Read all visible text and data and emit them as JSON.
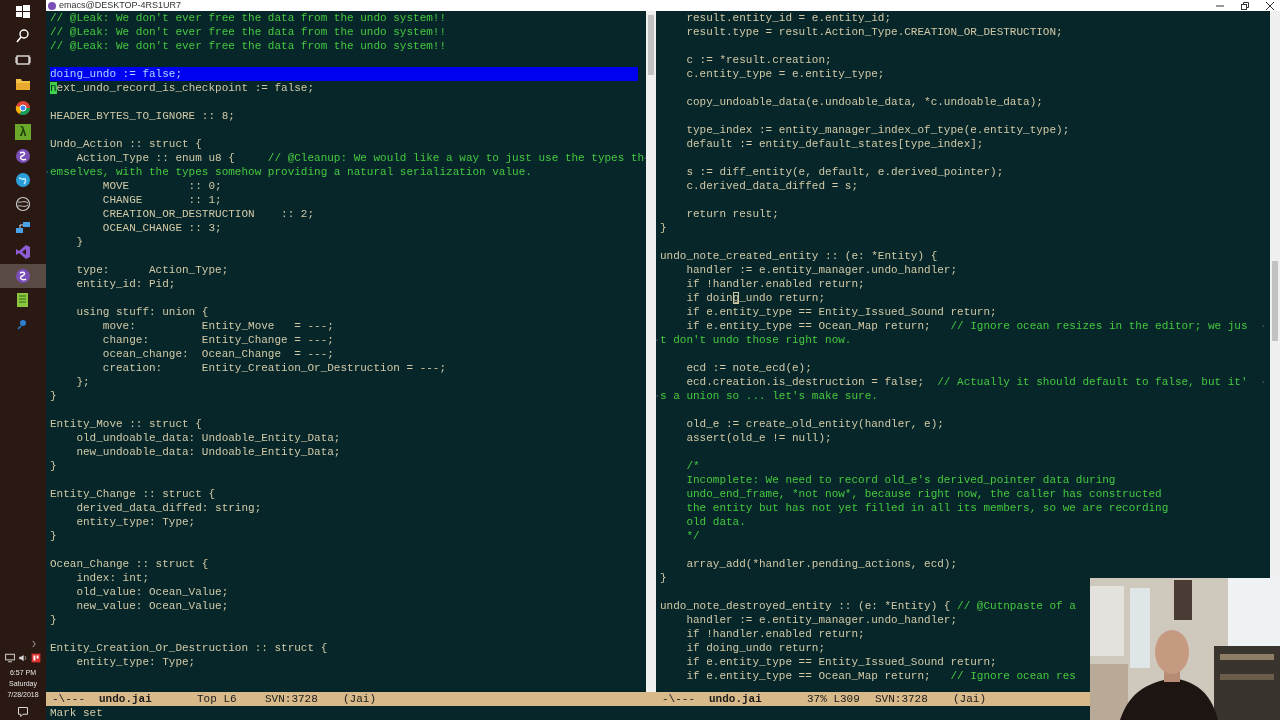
{
  "window": {
    "title": "emacs@DESKTOP-4RS1UR7"
  },
  "taskbar": {
    "items": [
      {
        "kind": "start",
        "selected": false
      },
      {
        "kind": "search",
        "selected": false
      },
      {
        "kind": "task_view",
        "selected": false
      },
      {
        "kind": "folder",
        "selected": false
      },
      {
        "kind": "browser",
        "selected": false
      },
      {
        "kind": "lambda",
        "glyph": "λ",
        "selected": false
      },
      {
        "kind": "emacs",
        "selected": false
      },
      {
        "kind": "globe",
        "selected": false
      },
      {
        "kind": "steam",
        "selected": false
      },
      {
        "kind": "network",
        "selected": false
      },
      {
        "kind": "studio",
        "selected": false
      },
      {
        "kind": "emacs",
        "selected": true
      },
      {
        "kind": "sheet",
        "selected": false
      },
      {
        "kind": "pin",
        "selected": false
      }
    ],
    "clock": {
      "time": "6:57 PM",
      "day": "Saturday",
      "date": "7/28/2018"
    }
  },
  "panes": [
    {
      "active": true,
      "lines": [
        {
          "kind": "comment",
          "text": "// @Leak: We don't ever free the data from the undo system!!"
        },
        {
          "kind": "comment",
          "text": "// @Leak: We don't ever free the data from the undo system!!"
        },
        {
          "kind": "comment",
          "text": "// @Leak: We don't ever free the data from the undo system!!"
        },
        {
          "kind": "blank"
        },
        {
          "kind": "region",
          "text": "doing_undo := false;"
        },
        {
          "kind": "cursor",
          "at": "n",
          "after": "ext_undo_record_is_checkpoint := false;"
        },
        {
          "kind": "blank"
        },
        {
          "kind": "code",
          "text": "HEADER_BYTES_TO_IGNORE :: 8;"
        },
        {
          "kind": "blank"
        },
        {
          "kind": "code",
          "text": "Undo_Action :: struct {"
        },
        {
          "kind": "code",
          "text": "    Action_Type :: enum u8 {     ",
          "comment": "// @Cleanup: We would like a way to just use the types th"
        },
        {
          "kind": "wrap",
          "text": "emselves, with the types somehow providing a natural serialization value."
        },
        {
          "kind": "code",
          "text": "        MOVE         :: 0;"
        },
        {
          "kind": "code",
          "text": "        CHANGE       :: 1;"
        },
        {
          "kind": "code",
          "text": "        CREATION_OR_DESTRUCTION    :: 2;"
        },
        {
          "kind": "code",
          "text": "        OCEAN_CHANGE :: 3;"
        },
        {
          "kind": "code",
          "text": "    }"
        },
        {
          "kind": "blank"
        },
        {
          "kind": "code",
          "text": "    type:      Action_Type;"
        },
        {
          "kind": "code",
          "text": "    entity_id: Pid;"
        },
        {
          "kind": "blank"
        },
        {
          "kind": "code",
          "text": "    using stuff: union {"
        },
        {
          "kind": "code",
          "text": "        move:          Entity_Move   = ---;"
        },
        {
          "kind": "code",
          "text": "        change:        Entity_Change = ---;"
        },
        {
          "kind": "code",
          "text": "        ocean_change:  Ocean_Change  = ---;"
        },
        {
          "kind": "code",
          "text": "        creation:      Entity_Creation_Or_Destruction = ---;"
        },
        {
          "kind": "code",
          "text": "    };"
        },
        {
          "kind": "code",
          "text": "}"
        },
        {
          "kind": "blank"
        },
        {
          "kind": "code",
          "text": "Entity_Move :: struct {"
        },
        {
          "kind": "code",
          "text": "    old_undoable_data: Undoable_Entity_Data;"
        },
        {
          "kind": "code",
          "text": "    new_undoable_data: Undoable_Entity_Data;"
        },
        {
          "kind": "code",
          "text": "}"
        },
        {
          "kind": "blank"
        },
        {
          "kind": "code",
          "text": "Entity_Change :: struct {"
        },
        {
          "kind": "code",
          "text": "    derived_data_diffed: string;"
        },
        {
          "kind": "code",
          "text": "    entity_type: Type;"
        },
        {
          "kind": "code",
          "text": "}"
        },
        {
          "kind": "blank"
        },
        {
          "kind": "code",
          "text": "Ocean_Change :: struct {"
        },
        {
          "kind": "code",
          "text": "    index: int;"
        },
        {
          "kind": "code",
          "text": "    old_value: Ocean_Value;"
        },
        {
          "kind": "code",
          "text": "    new_value: Ocean_Value;"
        },
        {
          "kind": "code",
          "text": "}"
        },
        {
          "kind": "blank"
        },
        {
          "kind": "code",
          "text": "Entity_Creation_Or_Destruction :: struct {"
        },
        {
          "kind": "code",
          "text": "    entity_type: Type;"
        }
      ],
      "mode_line": {
        "status": "-\\---",
        "buffer": "undo.jai",
        "position": "Top L6",
        "vc": "SVN:3728",
        "mode": "(Jai)"
      }
    },
    {
      "active": false,
      "lines": [
        {
          "kind": "code",
          "text": "    result.entity_id = e.entity_id;"
        },
        {
          "kind": "code",
          "text": "    result.type = result.Action_Type.CREATION_OR_DESTRUCTION;"
        },
        {
          "kind": "blank"
        },
        {
          "kind": "code",
          "text": "    c := *result.creation;"
        },
        {
          "kind": "code",
          "text": "    c.entity_type = e.entity_type;"
        },
        {
          "kind": "blank"
        },
        {
          "kind": "code",
          "text": "    copy_undoable_data(e.undoable_data, *c.undoable_data);"
        },
        {
          "kind": "blank"
        },
        {
          "kind": "code",
          "text": "    type_index := entity_manager_index_of_type(e.entity_type);"
        },
        {
          "kind": "code",
          "text": "    default := entity_default_states[type_index];"
        },
        {
          "kind": "blank"
        },
        {
          "kind": "code",
          "text": "    s := diff_entity(e, default, e.derived_pointer);"
        },
        {
          "kind": "code",
          "text": "    c.derived_data_diffed = s;"
        },
        {
          "kind": "blank"
        },
        {
          "kind": "code",
          "text": "    return result;"
        },
        {
          "kind": "code",
          "text": "}"
        },
        {
          "kind": "blank"
        },
        {
          "kind": "code",
          "text": "undo_note_created_entity :: (e: *Entity) {"
        },
        {
          "kind": "code",
          "text": "    handler := e.entity_manager.undo_handler;"
        },
        {
          "kind": "code",
          "text": "    if !handler.enabled return;"
        },
        {
          "kind": "cursor",
          "before": "    if doin",
          "at": "g",
          "after": "_undo return;"
        },
        {
          "kind": "code",
          "text": "    if e.entity_type == Entity_Issued_Sound return;"
        },
        {
          "kind": "code",
          "text": "    if e.entity_type == Ocean_Map return;   ",
          "comment": "// Ignore ocean resizes in the editor; we jus"
        },
        {
          "kind": "wrap",
          "text": "t don't undo those right now."
        },
        {
          "kind": "blank"
        },
        {
          "kind": "code",
          "text": "    ecd := note_ecd(e);"
        },
        {
          "kind": "code",
          "text": "    ecd.creation.is_destruction = false;  ",
          "comment": "// Actually it should default to false, but it'"
        },
        {
          "kind": "wrap",
          "text": "s a union so ... let's make sure."
        },
        {
          "kind": "blank"
        },
        {
          "kind": "code",
          "text": "    old_e := create_old_entity(handler, e);"
        },
        {
          "kind": "code",
          "text": "    assert(old_e != null);"
        },
        {
          "kind": "blank"
        },
        {
          "kind": "comment",
          "text": "    /*"
        },
        {
          "kind": "comment",
          "text": "    Incomplete: We need to record old_e's derived_pointer data during"
        },
        {
          "kind": "comment",
          "text": "    undo_end_frame, *not now*, because right now, the caller has constructed"
        },
        {
          "kind": "comment",
          "text": "    the entity but has not yet filled in all its members, so we are recording"
        },
        {
          "kind": "comment",
          "text": "    old data."
        },
        {
          "kind": "comment",
          "text": "    */"
        },
        {
          "kind": "blank"
        },
        {
          "kind": "code",
          "text": "    array_add(*handler.pending_actions, ecd);"
        },
        {
          "kind": "code",
          "text": "}"
        },
        {
          "kind": "blank"
        },
        {
          "kind": "code",
          "text": "undo_note_destroyed_entity :: (e: *Entity) { ",
          "comment": "// @Cutnpaste of a"
        },
        {
          "kind": "code",
          "text": "    handler := e.entity_manager.undo_handler;"
        },
        {
          "kind": "code",
          "text": "    if !handler.enabled return;"
        },
        {
          "kind": "code",
          "text": "    if doing_undo return;"
        },
        {
          "kind": "code",
          "text": "    if e.entity_type == Entity_Issued_Sound return;"
        },
        {
          "kind": "code",
          "text": "    if e.entity_type == Ocean_Map return;   ",
          "comment": "// Ignore ocean res"
        }
      ],
      "mode_line": {
        "status": "-\\---",
        "buffer": "undo.jai",
        "position": "37% L309",
        "vc": "SVN:3728",
        "mode": "(Jai)"
      }
    }
  ],
  "minibuffer": "Mark set"
}
